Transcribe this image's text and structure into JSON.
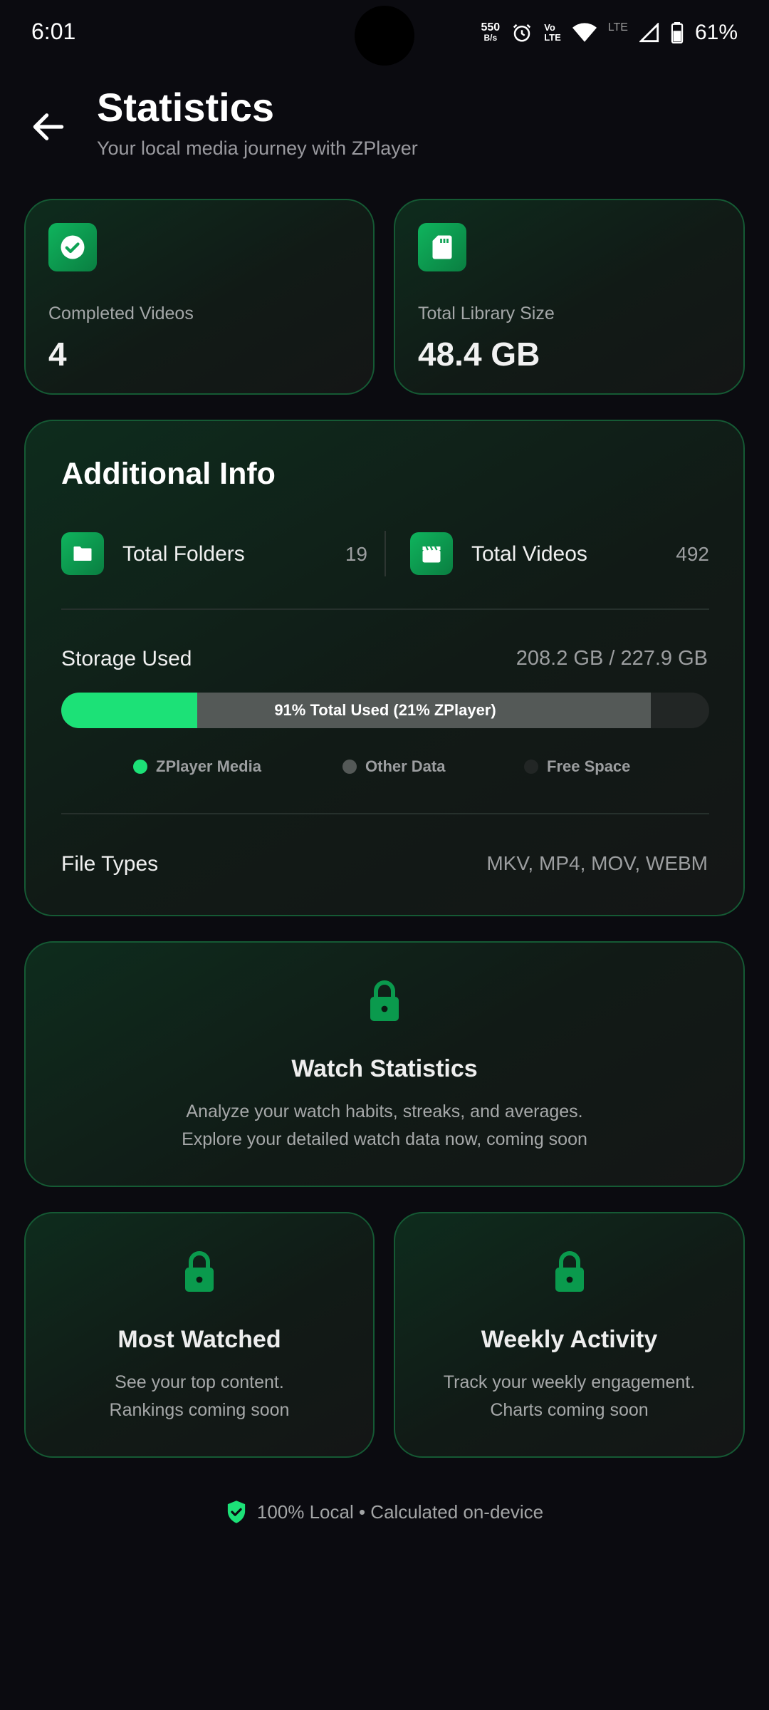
{
  "status_bar": {
    "time": "6:01",
    "speed_value": "550",
    "speed_unit": "B/s",
    "volte": "Vo¹⁄ LTE",
    "volte_top": "Vo",
    "volte_bottom": "LTE",
    "network": "LTE",
    "battery": "61%"
  },
  "header": {
    "title": "Statistics",
    "subtitle": "Your local media journey with ZPlayer"
  },
  "stats": {
    "completed_label": "Completed Videos",
    "completed_value": "4",
    "library_label": "Total Library Size",
    "library_value": "48.4 GB"
  },
  "additional_info": {
    "title": "Additional Info",
    "folders_label": "Total Folders",
    "folders_count": "19",
    "videos_label": "Total Videos",
    "videos_count": "492",
    "storage_label": "Storage Used",
    "storage_value": "208.2 GB / 227.9 GB",
    "storage_total_used_percent": 91,
    "storage_zplayer_percent": 21,
    "bar_text": "91% Total Used  (21% ZPlayer)",
    "legend": [
      {
        "label": "ZPlayer Media",
        "color": "#1ce177"
      },
      {
        "label": "Other Data",
        "color": "#545957"
      },
      {
        "label": "Free Space",
        "color": "#222625"
      }
    ],
    "file_types_label": "File Types",
    "file_types_value": "MKV, MP4, MOV, WEBM"
  },
  "watch_statistics": {
    "title": "Watch Statistics",
    "line1": "Analyze your watch habits, streaks, and averages.",
    "line2": "Explore your detailed watch data now, coming soon"
  },
  "most_watched": {
    "title": "Most Watched",
    "line1": "See your top content.",
    "line2": "Rankings coming soon"
  },
  "weekly_activity": {
    "title": "Weekly Activity",
    "line1": "Track your weekly engagement.",
    "line2": "Charts coming soon"
  },
  "footer": {
    "text": "100% Local • Calculated on-device"
  },
  "colors": {
    "accent": "#1ce177",
    "icon_green": "#0fb45d",
    "lock_green": "#0a9a4d",
    "background": "#0b0b10"
  }
}
